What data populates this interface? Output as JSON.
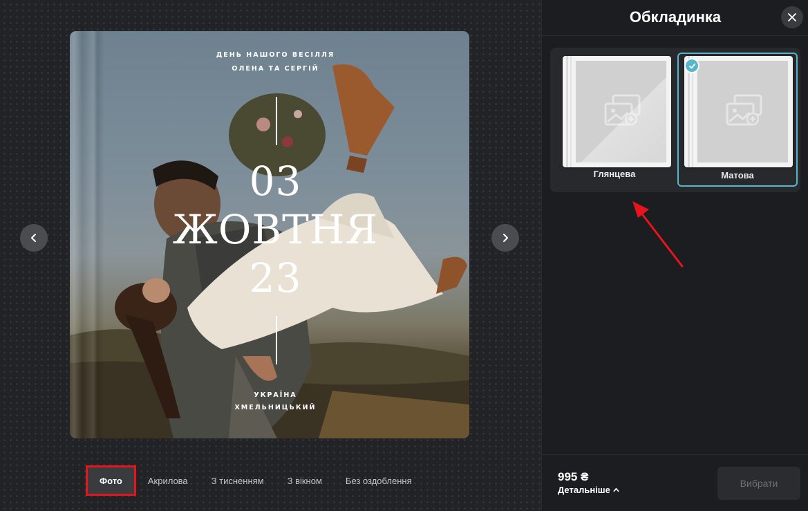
{
  "cover": {
    "line1": "ДЕНЬ НАШОГО ВЕСІЛЛЯ",
    "line2": "ОЛЕНА ТА СЕРГІЙ",
    "day": "03",
    "month": "ЖОВТНЯ",
    "year": "23",
    "country": "УКРАЇНА",
    "city": "ХМЕЛЬНИЦЬКИЙ"
  },
  "navigation": {
    "prev_icon": "chevron-left-icon",
    "next_icon": "chevron-right-icon"
  },
  "tabs": [
    {
      "label": "Фото",
      "active": true
    },
    {
      "label": "Акрилова",
      "active": false
    },
    {
      "label": "З тисненням",
      "active": false
    },
    {
      "label": "З вікном",
      "active": false
    },
    {
      "label": "Без оздоблення",
      "active": false
    }
  ],
  "panel": {
    "title": "Обкладинка",
    "close_icon": "close-icon",
    "options": [
      {
        "label": "Глянцева",
        "selected": false
      },
      {
        "label": "Матова",
        "selected": true
      }
    ],
    "price": "995 ₴",
    "details_label": "Детальніше",
    "select_label": "Вибрати"
  },
  "colors": {
    "accent": "#57b6cc",
    "highlight": "#e8141c",
    "panel_bg": "#1c1d20"
  }
}
